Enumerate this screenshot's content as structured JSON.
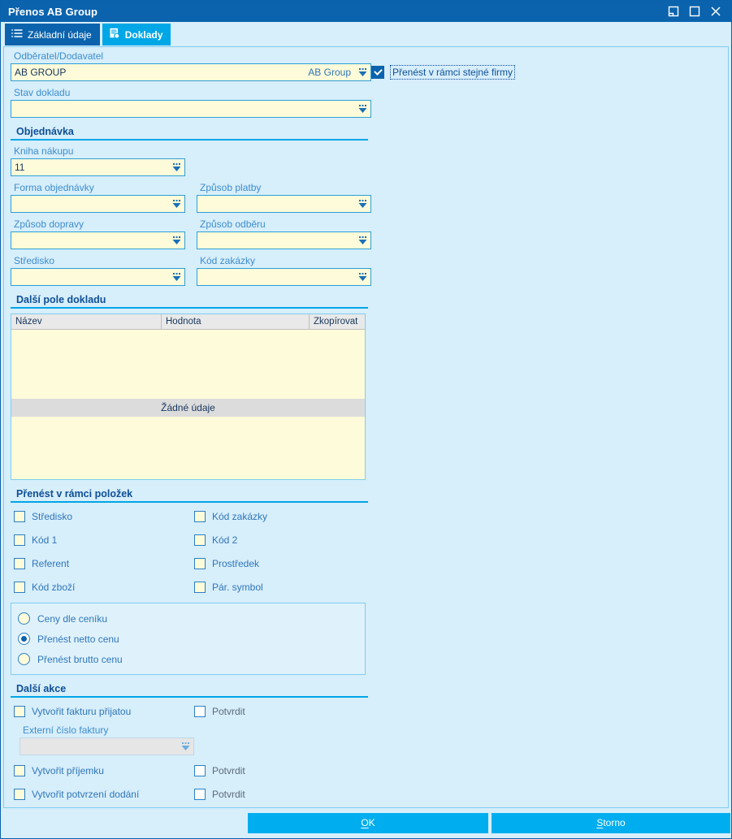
{
  "window": {
    "title": "Přenos AB Group",
    "controls": [
      {
        "name": "restore-down-icon",
        "label": "Obnovit"
      },
      {
        "name": "maximize-icon",
        "label": "Maximalizovat"
      },
      {
        "name": "close-icon",
        "label": "Zavřít"
      }
    ]
  },
  "tabs": [
    {
      "label": "Základní údaje",
      "icon": "list-lines-icon",
      "active": false
    },
    {
      "label": "Doklady",
      "icon": "document-icon",
      "active": true
    }
  ],
  "top": {
    "partner_label": "Odběratel/Dodavatel",
    "partner_value": "AB GROUP",
    "partner_hint": "AB Group",
    "state_label": "Stav dokladu",
    "state_value": "",
    "same_company_label": "Přenést v rámci stejné firmy",
    "same_company_checked": "true"
  },
  "order": {
    "heading": "Objednávka",
    "book_label": "Kniha nákupu",
    "book_value": "11",
    "form_label": "Forma objednávky",
    "form_value": "",
    "payment_label": "Způsob platby",
    "payment_value": "",
    "transport_label": "Způsob dopravy",
    "transport_value": "",
    "pickup_label": "Způsob odběru",
    "pickup_value": "",
    "center_label": "Středisko",
    "center_value": "",
    "ordercode_label": "Kód zakázky",
    "ordercode_value": ""
  },
  "extra_fields": {
    "heading": "Další pole dokladu",
    "columns": [
      "Název",
      "Hodnota",
      "Zkopírovat"
    ],
    "empty_text": "Žádné údaje",
    "rows": []
  },
  "items_transfer": {
    "heading": "Přenést v rámci položek",
    "checkboxes_left": [
      {
        "label": "Středisko",
        "checked": "false"
      },
      {
        "label": "Kód 1",
        "checked": "false"
      },
      {
        "label": "Referent",
        "checked": "false"
      },
      {
        "label": "Kód zboží",
        "checked": "false"
      }
    ],
    "checkboxes_right": [
      {
        "label": "Kód zakázky",
        "checked": "false"
      },
      {
        "label": "Kód 2",
        "checked": "false"
      },
      {
        "label": "Prostředek",
        "checked": "false"
      },
      {
        "label": "Pár. symbol",
        "checked": "false"
      }
    ],
    "price_options": [
      {
        "label": "Ceny dle ceníku",
        "selected": "false"
      },
      {
        "label": "Přenést netto cenu",
        "selected": "true"
      },
      {
        "label": "Přenést brutto cenu",
        "selected": "false"
      }
    ]
  },
  "other_actions": {
    "heading": "Další akce",
    "invoice_label": "Vytvořit fakturu přijatou",
    "invoice_checked": "false",
    "invoice_confirm_label": "Potvrdit",
    "invoice_confirm_checked": "false",
    "ext_invoice_label": "Externí číslo faktury",
    "ext_invoice_value": "",
    "receipt_label": "Vytvořit příjemku",
    "receipt_checked": "false",
    "receipt_confirm_label": "Potvrdit",
    "receipt_confirm_checked": "false",
    "delivery_label": "Vytvořit potvrzení dodání",
    "delivery_checked": "false",
    "delivery_confirm_label": "Potvrdit",
    "delivery_confirm_checked": "false"
  },
  "footer": {
    "ok_label": "OK",
    "ok_accel": "O",
    "ok_rest": "K",
    "cancel_label": "Storno",
    "cancel_accel": "S",
    "cancel_rest": "torno"
  },
  "colors": {
    "titlebar": "#0b63ad",
    "accent": "#00a7e7",
    "button": "#00aeef",
    "panel_bg": "#d7eefb",
    "field_bg": "#fdfbd9",
    "field_border": "#2e9fd8",
    "label_text": "#3c8dcd",
    "heading_text": "#0d4f96"
  }
}
